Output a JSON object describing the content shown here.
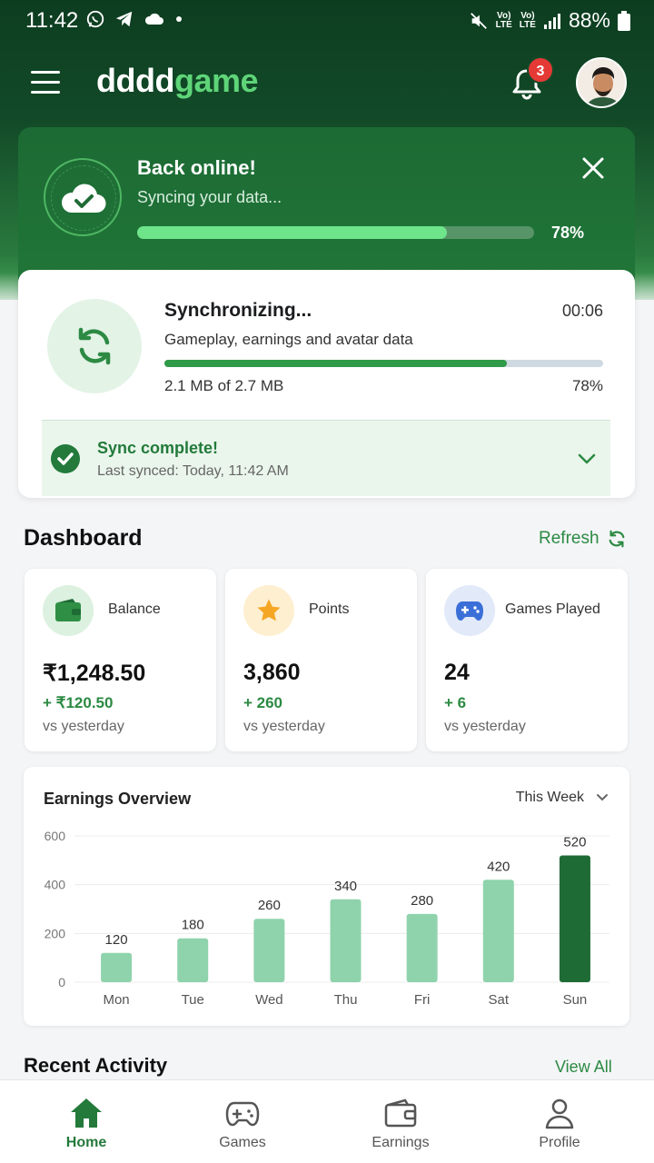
{
  "status_bar": {
    "time": "11:42",
    "battery": "88%",
    "network_1": "LTE",
    "network_2": "LTE"
  },
  "header": {
    "logo_part1": "dddd",
    "logo_part2": "game",
    "notification_count": "3"
  },
  "online_banner": {
    "title": "Back online!",
    "subtitle": "Syncing your data...",
    "progress": 0.78,
    "percent": "78%"
  },
  "sync": {
    "title": "Synchronizing...",
    "timer": "00:06",
    "description": "Gameplay, earnings and avatar data",
    "size": "2.1 MB of 2.7 MB",
    "percent": "78%",
    "progress": 0.78,
    "complete_title": "Sync complete!",
    "complete_sub": "Last synced: Today, 11:42 AM"
  },
  "dashboard": {
    "title": "Dashboard",
    "refresh": "Refresh",
    "stats": [
      {
        "label": "Balance",
        "value": "₹1,248.50",
        "delta": "+ ₹120.50",
        "vs": "vs yesterday",
        "icon": "wallet-icon"
      },
      {
        "label": "Points",
        "value": "3,860",
        "delta": "+ 260",
        "vs": "vs yesterday",
        "icon": "star-icon"
      },
      {
        "label": "Games Played",
        "value": "24",
        "delta": "+ 6",
        "vs": "vs yesterday",
        "icon": "gamepad-icon"
      }
    ]
  },
  "earnings": {
    "title": "Earnings Overview",
    "range": "This Week"
  },
  "chart_data": {
    "type": "bar",
    "title": "Earnings Overview",
    "categories": [
      "Mon",
      "Tue",
      "Wed",
      "Thu",
      "Fri",
      "Sat",
      "Sun"
    ],
    "values": [
      120,
      180,
      260,
      340,
      280,
      420,
      520
    ],
    "ylim": [
      0,
      600
    ],
    "yticks": [
      0,
      200,
      400,
      600
    ],
    "grid": true,
    "highlight": "Sun",
    "colors": {
      "bar": "#8fd3ac",
      "highlight": "#1f6b35"
    }
  },
  "recent": {
    "title": "Recent Activity",
    "view_all": "View All"
  },
  "nav": {
    "items": [
      {
        "label": "Home",
        "icon": "home-icon"
      },
      {
        "label": "Games",
        "icon": "gamepad-icon"
      },
      {
        "label": "Earnings",
        "icon": "wallet-icon"
      },
      {
        "label": "Profile",
        "icon": "user-icon"
      }
    ],
    "active": "Home"
  },
  "colors": {
    "brand_green": "#237a3b",
    "accent_green": "#5fd479",
    "badge_red": "#e53935"
  }
}
